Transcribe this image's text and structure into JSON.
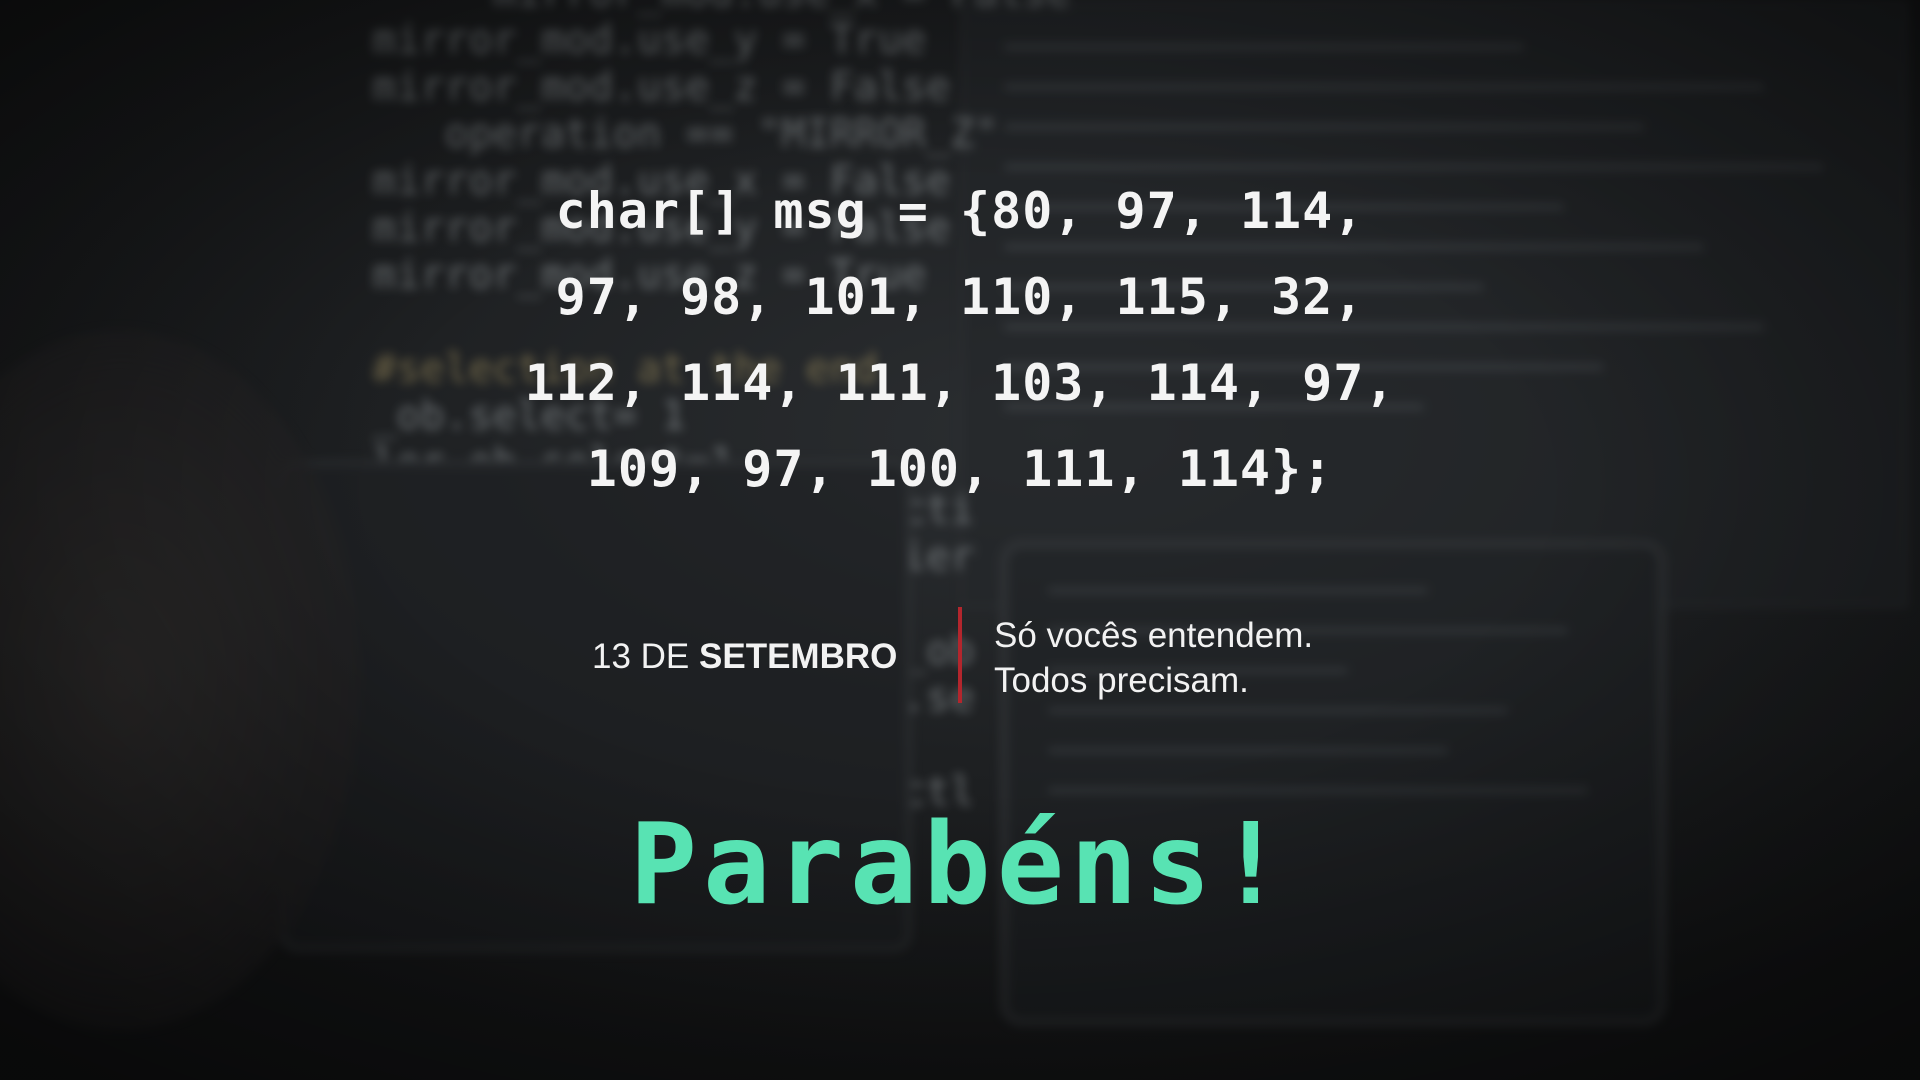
{
  "code": {
    "lines": [
      "char[] msg = {80, 97, 114,",
      "97, 98, 101, 110, 115, 32,",
      "112, 114, 111, 103, 114, 97,",
      "109, 97, 100, 111, 114};"
    ]
  },
  "date": {
    "day": "13 DE",
    "month": "SETEMBRO"
  },
  "tagline": {
    "line1": "Só vocês entendem.",
    "line2": "Todos precisam."
  },
  "headline": "Parabéns!",
  "colors": {
    "accent_green": "#58e3b3",
    "divider_red": "#b3262d",
    "text_white": "#f4f4f4",
    "background": "#1a1c1e"
  }
}
